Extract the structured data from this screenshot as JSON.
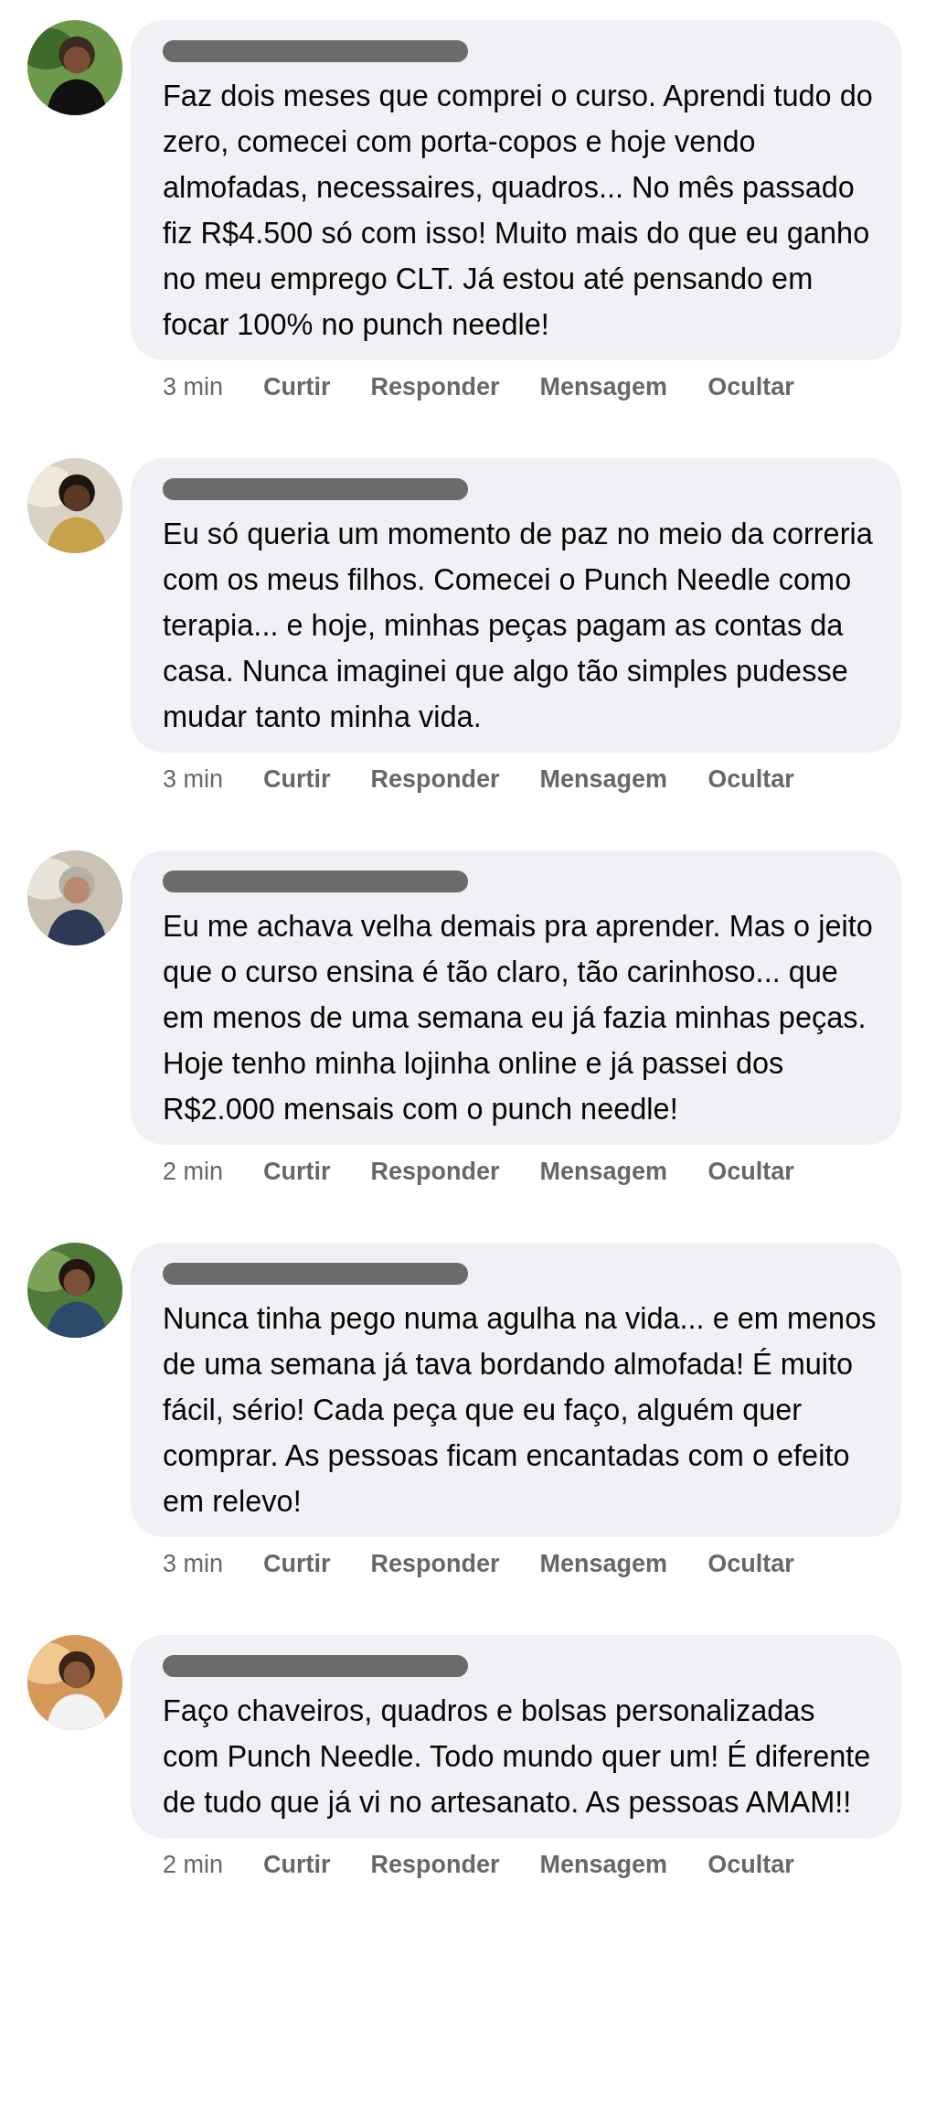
{
  "comments": [
    {
      "text": "Faz dois meses que comprei o curso. Aprendi tudo do zero, comecei com porta-copos e hoje vendo almofadas, necessaires, quadros... No mês passado fiz R$4.500 só com isso! Muito mais do que eu ganho no meu emprego CLT. Já estou até pensando em focar 100% no punch needle!",
      "time": "3 min",
      "actions": [
        "Curtir",
        "Responder",
        "Mensagem",
        "Ocultar"
      ]
    },
    {
      "text": "Eu só queria um momento de paz no meio da correria com os meus filhos. Comecei o Punch Needle como terapia... e hoje, minhas peças pagam as contas da casa. Nunca imaginei que algo tão simples pudesse mudar tanto minha vida.",
      "time": "3 min",
      "actions": [
        "Curtir",
        "Responder",
        "Mensagem",
        "Ocultar"
      ]
    },
    {
      "text": "Eu me achava velha demais pra aprender. Mas o jeito que o curso ensina é tão claro, tão carinhoso... que em menos de uma semana eu já fazia minhas peças. Hoje tenho minha lojinha online e já passei dos R$2.000 mensais com o punch needle!",
      "time": "2 min",
      "actions": [
        "Curtir",
        "Responder",
        "Mensagem",
        "Ocultar"
      ]
    },
    {
      "text": "Nunca tinha pego numa agulha na vida... e em menos de uma semana já tava bordando almofada! É muito fácil, sério! Cada peça que eu faço, alguém quer comprar. As pessoas ficam encantadas com o efeito em relevo!",
      "time": "3 min",
      "actions": [
        "Curtir",
        "Responder",
        "Mensagem",
        "Ocultar"
      ]
    },
    {
      "text": "Faço chaveiros, quadros e bolsas personalizadas com Punch Needle. Todo mundo quer um! É diferente de tudo que já vi no artesanato. As pessoas AMAM!!",
      "time": "2 min",
      "actions": [
        "Curtir",
        "Responder",
        "Mensagem",
        "Ocultar"
      ]
    }
  ]
}
